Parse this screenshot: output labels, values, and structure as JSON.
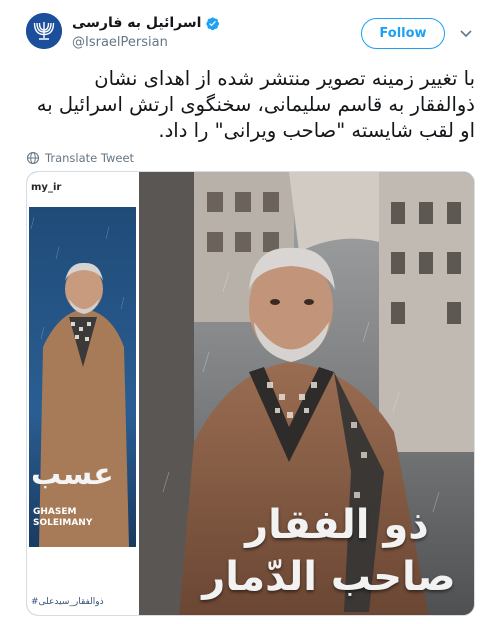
{
  "tweet": {
    "display_name": "اسرائیل به فارسی",
    "handle": "@IsraelPersian",
    "follow_label": "Follow",
    "text": "با تغییر زمینه تصویر منتشر شده از اهدای نشان ذوالفقار به قاسم سلیمانی، سخنگوی ارتش اسرائیل به او لقب شایسته \"صاحب ویرانی\" را داد.",
    "translate_label": "Translate Tweet"
  },
  "media": {
    "left": {
      "username": "my_ir",
      "poster_title": "عسب",
      "poster_name": "GHASEM SOLEIMANY",
      "caption": "ذوالفقار_سیدعلی#"
    },
    "right": {
      "line1": "ذو الفقار",
      "line2": "صاحب الدّمار"
    }
  },
  "colors": {
    "accent": "#1da1f2",
    "text": "#14171a",
    "secondary": "#657786",
    "avatar_bg": "#1b4f9c"
  },
  "icons": {
    "verified": "verified-badge-icon",
    "chevron": "chevron-down-icon",
    "translate": "globe-icon",
    "avatar": "menorah-logo"
  }
}
